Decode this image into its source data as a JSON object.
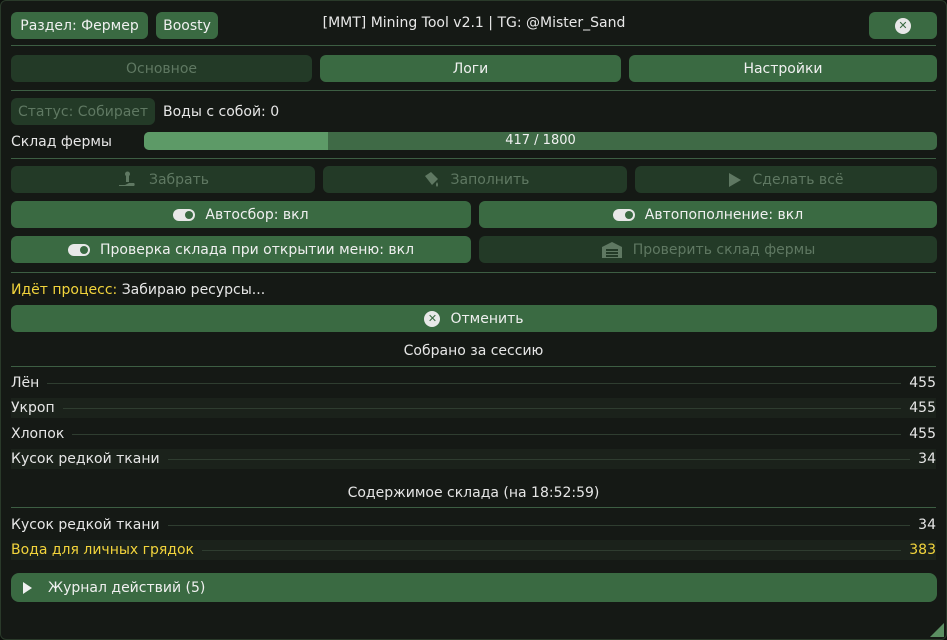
{
  "titlebar": {
    "section_label": "Раздел: Фермер",
    "boosty_label": "Boosty",
    "title": "[MMT] Mining Tool v2.1 | TG: @Mister_Sand"
  },
  "tabs": [
    {
      "label": "Основное",
      "active": true
    },
    {
      "label": "Логи",
      "active": false
    },
    {
      "label": "Настройки",
      "active": false
    }
  ],
  "status": {
    "badge": "Статус: Собирает",
    "water_carried": "Воды с собой: 0"
  },
  "storage": {
    "label": "Склад фермы",
    "current": 417,
    "max": 1800,
    "text": "417 / 1800"
  },
  "actions": {
    "collect": "Забрать",
    "fill": "Заполнить",
    "do_all": "Сделать всё",
    "auto_collect": "Автосбор: вкл",
    "auto_refill": "Автопополнение: вкл",
    "check_on_open": "Проверка склада при открытии меню: вкл",
    "check_storage": "Проверить склад фермы"
  },
  "process": {
    "label": "Идёт процесс:",
    "text": "Забираю ресурсы...",
    "cancel": "Отменить"
  },
  "session": {
    "title": "Собрано за сессию",
    "items": [
      {
        "name": "Лён",
        "value": "455"
      },
      {
        "name": "Укроп",
        "value": "455"
      },
      {
        "name": "Хлопок",
        "value": "455"
      },
      {
        "name": "Кусок редкой ткани",
        "value": "34"
      }
    ]
  },
  "warehouse": {
    "title": "Содержимое склада (на 18:52:59)",
    "items": [
      {
        "name": "Кусок редкой ткани",
        "value": "34"
      },
      {
        "name": "Вода для личных грядок",
        "value": "383"
      }
    ]
  },
  "journal": {
    "label": "Журнал действий (5)"
  },
  "colors": {
    "button": "#3a6a42",
    "button_dim": "#233a27",
    "highlight": "#f2d43c",
    "background": "#151915"
  }
}
